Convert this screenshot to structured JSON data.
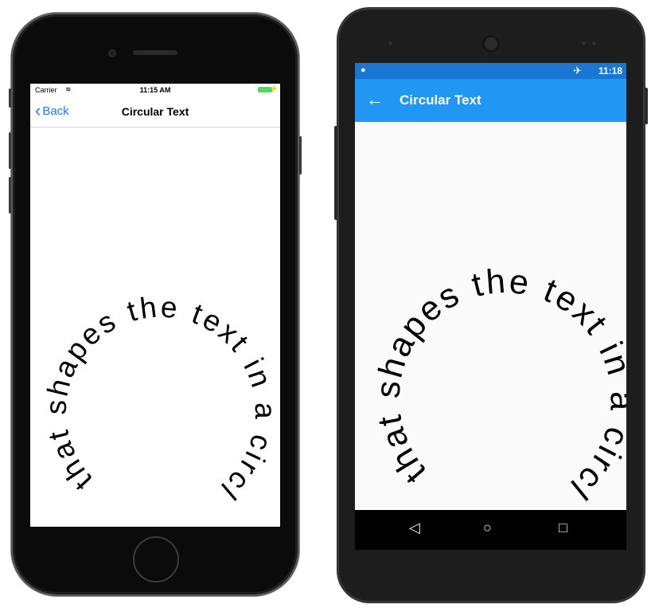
{
  "ios": {
    "status": {
      "carrier": "Carrier",
      "wifi_icon": "≋",
      "time": "11:15 AM"
    },
    "nav": {
      "back_label": "Back",
      "title": "Circular Text"
    }
  },
  "android": {
    "status": {
      "icons": "✈",
      "time": "11:18"
    },
    "appbar": {
      "title": "Circular Text"
    }
  },
  "circular_text": "that shapes the text in a circle",
  "colors": {
    "ios_accent": "#1a7cf5",
    "android_primary": "#2196f3",
    "android_status": "#1976d2",
    "ios_battery": "#4cd964"
  }
}
